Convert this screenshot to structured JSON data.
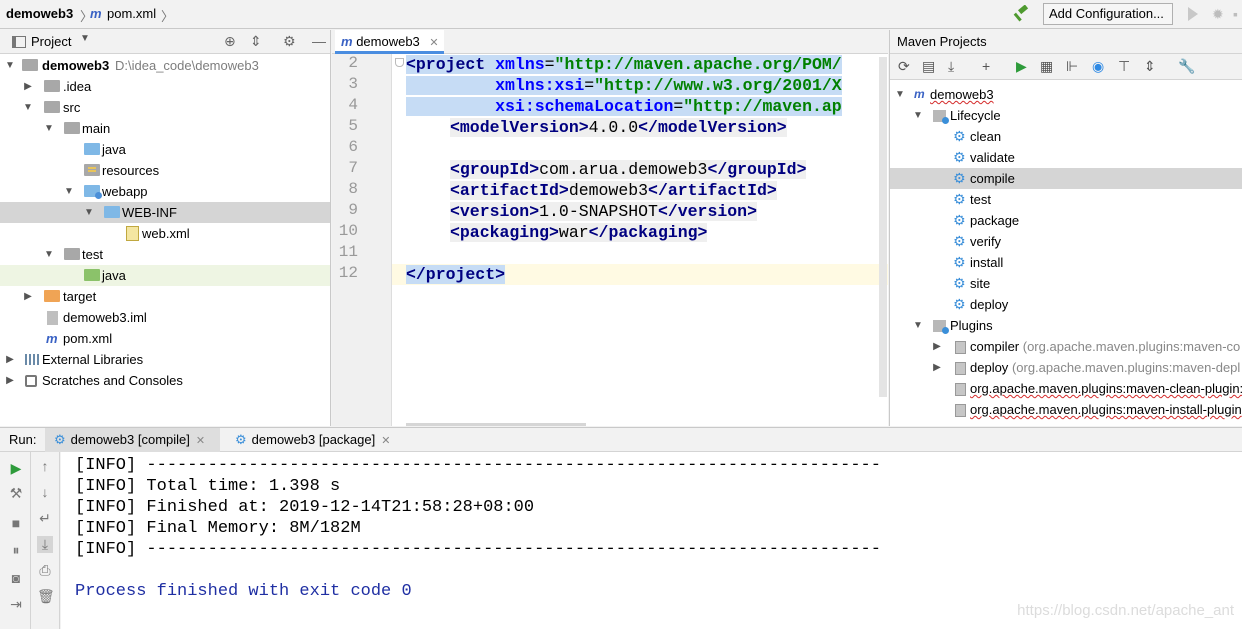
{
  "navbar": {
    "project": "demoweb3",
    "file_icon": "m",
    "file": "pom.xml",
    "add_config": "Add Configuration..."
  },
  "project_panel": {
    "title": "Project",
    "tree": [
      {
        "label": "demoweb3",
        "path": "D:\\idea_code\\demoweb3",
        "icon": "module-folder-icon"
      },
      {
        "label": ".idea",
        "icon": "folder-icon"
      },
      {
        "label": "src",
        "icon": "folder-icon"
      },
      {
        "label": "main",
        "icon": "folder-icon"
      },
      {
        "label": "java",
        "icon": "source-folder-icon"
      },
      {
        "label": "resources",
        "icon": "resources-folder-icon"
      },
      {
        "label": "webapp",
        "icon": "web-folder-icon"
      },
      {
        "label": "WEB-INF",
        "icon": "source-folder-icon"
      },
      {
        "label": "web.xml",
        "icon": "xml-file-icon"
      },
      {
        "label": "test",
        "icon": "folder-icon"
      },
      {
        "label": "java",
        "icon": "test-folder-icon"
      },
      {
        "label": "target",
        "icon": "excluded-folder-icon"
      },
      {
        "label": "demoweb3.iml",
        "icon": "iml-file-icon"
      },
      {
        "label": "pom.xml",
        "icon": "maven-file-icon"
      },
      {
        "label": "External Libraries",
        "icon": "libraries-icon"
      },
      {
        "label": "Scratches and Consoles",
        "icon": "scratches-icon"
      }
    ]
  },
  "editor": {
    "tab": "demoweb3",
    "line_numbers": [
      "2",
      "3",
      "4",
      "5",
      "6",
      "7",
      "8",
      "9",
      "10",
      "11",
      "12"
    ],
    "lines": {
      "l2_open": "<project",
      "l2_attr": "xmlns",
      "l2_val": "\"http://maven.apache.org/POM/",
      "l3_attr": "xmlns:xsi",
      "l3_val": "\"http://www.w3.org/2001/X",
      "l4_attr": "xsi:schemaLocation",
      "l4_val": "\"http://maven.ap",
      "model_open": "<modelVersion>",
      "model_val": "4.0.0",
      "model_close": "</modelVersion>",
      "group_open": "<groupId>",
      "group_val": "com.arua.demoweb3",
      "group_close": "</groupId>",
      "artifact_open": "<artifactId>",
      "artifact_val": "demoweb3",
      "artifact_close": "</artifactId>",
      "version_open": "<version>",
      "version_val": "1.0-SNAPSHOT",
      "version_close": "</version>",
      "packaging_open": "<packaging>",
      "packaging_val": "war",
      "packaging_close": "</packaging>",
      "project_close": "</project>"
    }
  },
  "maven_panel": {
    "title": "Maven Projects",
    "root": "demoweb3",
    "lifecycle_label": "Lifecycle",
    "lifecycle": [
      "clean",
      "validate",
      "compile",
      "test",
      "package",
      "verify",
      "install",
      "site",
      "deploy"
    ],
    "plugins_label": "Plugins",
    "plugins": [
      {
        "name": "compiler",
        "detail": "(org.apache.maven.plugins:maven-co"
      },
      {
        "name": "deploy",
        "detail": "(org.apache.maven.plugins:maven-depl"
      },
      {
        "name": "org.apache.maven.plugins:maven-clean-plugin:",
        "detail": ""
      },
      {
        "name": "org.apache.maven.plugins:maven-install-plugin",
        "detail": ""
      }
    ]
  },
  "run": {
    "label": "Run:",
    "tabs": [
      {
        "label": "demoweb3 [compile]"
      },
      {
        "label": "demoweb3 [package]"
      }
    ],
    "output": [
      "[INFO] ------------------------------------------------------------------------",
      "[INFO] Total time: 1.398 s",
      "[INFO] Finished at: 2019-12-14T21:58:28+08:00",
      "[INFO] Final Memory: 8M/182M",
      "[INFO] ------------------------------------------------------------------------",
      "",
      "Process finished with exit code 0"
    ],
    "watermark": "https://blog.csdn.net/apache_ant"
  }
}
